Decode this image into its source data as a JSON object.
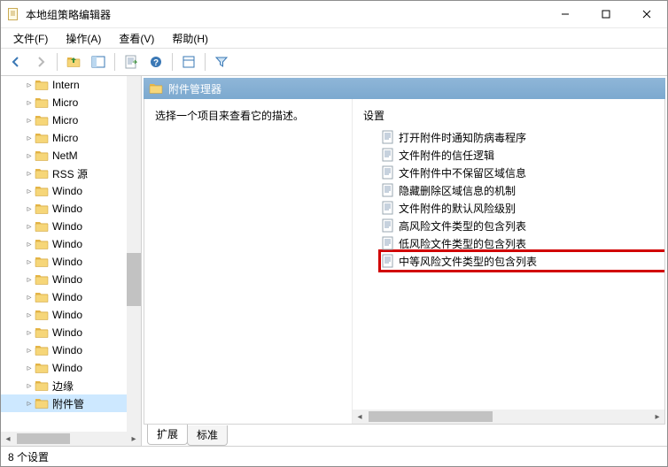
{
  "title": "本地组策略编辑器",
  "menus": {
    "file": "文件(F)",
    "action": "操作(A)",
    "view": "查看(V)",
    "help": "帮助(H)"
  },
  "tree": {
    "items": [
      {
        "label": "Intern"
      },
      {
        "label": "Micro"
      },
      {
        "label": "Micro"
      },
      {
        "label": "Micro"
      },
      {
        "label": "NetM"
      },
      {
        "label": "RSS 源"
      },
      {
        "label": "Windo"
      },
      {
        "label": "Windo"
      },
      {
        "label": "Windo"
      },
      {
        "label": "Windo"
      },
      {
        "label": "Windo"
      },
      {
        "label": "Windo"
      },
      {
        "label": "Windo"
      },
      {
        "label": "Windo"
      },
      {
        "label": "Windo"
      },
      {
        "label": "Windo"
      },
      {
        "label": "Windo"
      },
      {
        "label": "边缘"
      },
      {
        "label": "附件管",
        "selected": true
      }
    ]
  },
  "content": {
    "header_title": "附件管理器",
    "description": "选择一个项目来查看它的描述。",
    "settings_header": "设置",
    "settings": [
      {
        "label": "打开附件时通知防病毒程序"
      },
      {
        "label": "文件附件的信任逻辑"
      },
      {
        "label": "文件附件中不保留区域信息"
      },
      {
        "label": "隐藏删除区域信息的机制"
      },
      {
        "label": "文件附件的默认风险级别"
      },
      {
        "label": "高风险文件类型的包含列表"
      },
      {
        "label": "低风险文件类型的包含列表"
      },
      {
        "label": "中等风险文件类型的包含列表",
        "highlighted": true
      }
    ]
  },
  "tabs": {
    "extended": "扩展",
    "standard": "标准"
  },
  "status": "8 个设置"
}
